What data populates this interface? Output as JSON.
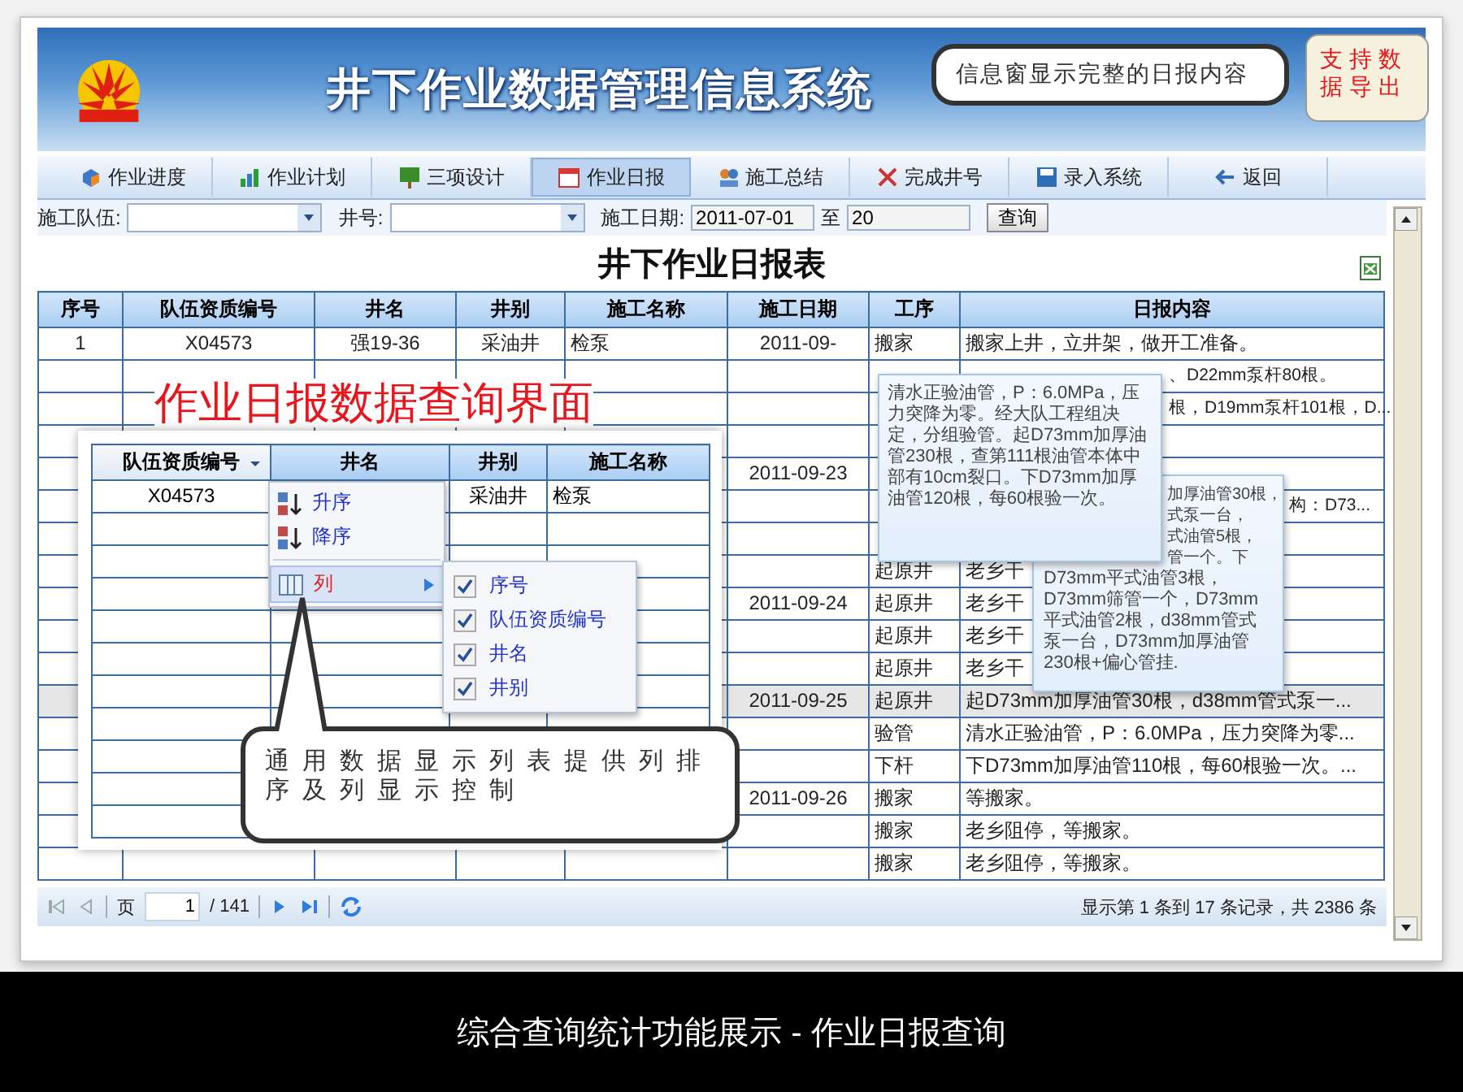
{
  "banner": {
    "title": "井下作业数据管理信息系统"
  },
  "tabs": [
    {
      "label": "作业进度",
      "selected": false
    },
    {
      "label": "作业计划",
      "selected": false
    },
    {
      "label": "三项设计",
      "selected": false
    },
    {
      "label": "作业日报",
      "selected": true
    },
    {
      "label": "施工总结",
      "selected": false
    },
    {
      "label": "完成井号",
      "selected": false
    },
    {
      "label": "录入系统",
      "selected": false
    },
    {
      "label": "返回",
      "selected": false
    }
  ],
  "filters": {
    "team_label": "施工队伍:",
    "well_label": "井号:",
    "date_label": "施工日期:",
    "date_from": "2011-07-01",
    "date_sep": "至",
    "date_to": "20",
    "query_button": "查询"
  },
  "report_title": "井下作业日报表",
  "table": {
    "columns": [
      "序号",
      "队伍资质编号",
      "井名",
      "井别",
      "施工名称",
      "施工日期",
      "工序",
      "日报内容"
    ],
    "rows": [
      {
        "selected": false,
        "cells": {
          "seq": "1",
          "team_code": "X04573",
          "well": "强19-36",
          "well_type": "采油井",
          "job": "检泵",
          "date": "2011-09-",
          "step": "搬家",
          "content": "搬家上井，立井架，做开工准备。"
        }
      },
      {
        "selected": false,
        "cells": {
          "content": "、D22mm泵杆80根。"
        }
      },
      {
        "selected": false,
        "cells": {
          "content": "根，D19mm泵杆101根，D..."
        }
      },
      {
        "selected": false,
        "cells": {}
      },
      {
        "selected": false,
        "cells": {
          "date": "2011-09-23"
        }
      },
      {
        "selected": false,
        "cells": {
          "content": "构：D73..."
        }
      },
      {
        "selected": false,
        "cells": {}
      },
      {
        "selected": false,
        "cells": {
          "step": "起原井",
          "content": "老乡干"
        }
      },
      {
        "selected": false,
        "cells": {
          "date": "2011-09-24",
          "step": "起原井",
          "content": "老乡干"
        }
      },
      {
        "selected": false,
        "cells": {
          "step": "起原井",
          "content": "老乡干"
        }
      },
      {
        "selected": false,
        "cells": {
          "step": "起原井",
          "content": "老乡干"
        }
      },
      {
        "selected": true,
        "cells": {
          "date": "2011-09-25",
          "step": "起原井",
          "content": "起D73mm加厚油管30根，d38mm管式泵一..."
        }
      },
      {
        "selected": false,
        "cells": {
          "step": "验管",
          "content": "清水正验油管，P：6.0MPa，压力突降为零..."
        }
      },
      {
        "selected": false,
        "cells": {
          "step": "下杆",
          "content": "下D73mm加厚油管110根，每60根验一次。..."
        }
      },
      {
        "selected": false,
        "cells": {
          "date": "2011-09-26",
          "step": "搬家",
          "content": "等搬家。"
        }
      },
      {
        "selected": false,
        "cells": {
          "step": "搬家",
          "content": "老乡阻停，等搬家。"
        }
      },
      {
        "selected": false,
        "cells": {
          "step": "搬家",
          "content": "老乡阻停，等搬家。"
        }
      }
    ]
  },
  "info_tooltip": {
    "text": "清水正验油管，P：6.0MPa，压力突降为零。经大队工程组决定，分组验管。起D73mm加厚油管230根，查第111根油管本体中部有10cm裂口。下D73mm加厚油管120根，每60根验一次。"
  },
  "info_tooltip_behind": {
    "lines": [
      {
        "text": "加厚油管30根，",
        "cut": true
      },
      {
        "text": "式泵一台，",
        "cut": true
      },
      {
        "text": "式油管5根，",
        "cut": true
      },
      {
        "text": "管一个。下",
        "cut": true
      },
      {
        "text": "D73mm平式油管3根，",
        "cut": false
      },
      {
        "text": "D73mm筛管一个，D73mm",
        "cut": false
      },
      {
        "text": "平式油管2根，d38mm管式",
        "cut": false
      },
      {
        "text": "泵一台，D73mm加厚油管",
        "cut": false
      },
      {
        "text": "230根+偏心管挂.",
        "cut": false
      }
    ]
  },
  "inset": {
    "title": "作业日报数据查询界面",
    "columns": [
      {
        "label": "队伍资质编号",
        "menu_open": true
      },
      {
        "label": "井名",
        "menu_open": false
      },
      {
        "label": "井别",
        "menu_open": false
      },
      {
        "label": "施工名称",
        "menu_open": false
      }
    ],
    "first_row": {
      "team_code": "X04573",
      "well_type": "采油井",
      "job": "检泵"
    },
    "menu": [
      {
        "label": "升序",
        "kind": "sort_asc",
        "selected": false
      },
      {
        "label": "降序",
        "kind": "sort_desc",
        "selected": false
      },
      {
        "label": "列",
        "kind": "columns",
        "selected": true
      }
    ],
    "submenu": [
      {
        "label": "序号",
        "checked": true
      },
      {
        "label": "队伍资质编号",
        "checked": true
      },
      {
        "label": "井名",
        "checked": true
      },
      {
        "label": "井别",
        "checked": true
      }
    ]
  },
  "callout_columns": {
    "text": "通用数据显示列表提供列排序及列显示控制"
  },
  "callout_tooltip": {
    "text": "信息窗显示完整的日报内容"
  },
  "callout_export": {
    "text": "支持数据导出"
  },
  "pager": {
    "page_label": "页",
    "page": "1",
    "total_pages": "/ 141",
    "summary": "显示第 1 条到 17 条记录，共 2386 条"
  },
  "caption": "综合查询统计功能展示 - 作业日报查询"
}
